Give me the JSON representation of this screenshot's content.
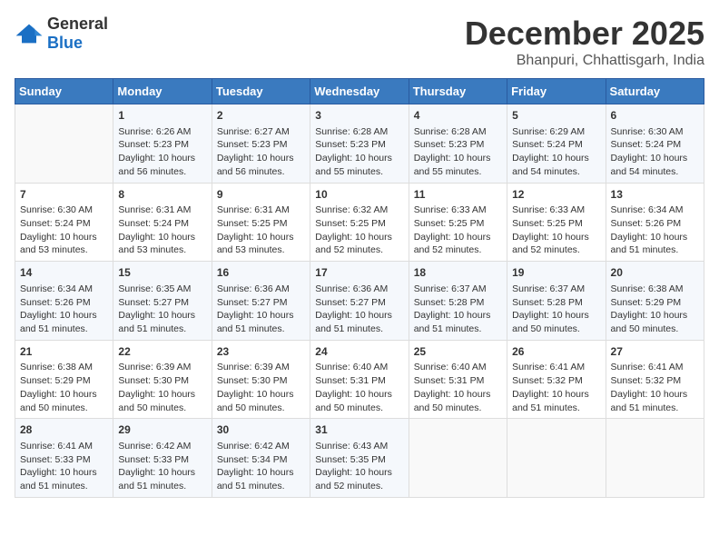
{
  "header": {
    "logo_general": "General",
    "logo_blue": "Blue",
    "month": "December 2025",
    "location": "Bhanpuri, Chhattisgarh, India"
  },
  "weekdays": [
    "Sunday",
    "Monday",
    "Tuesday",
    "Wednesday",
    "Thursday",
    "Friday",
    "Saturday"
  ],
  "weeks": [
    [
      {
        "day": "",
        "info": ""
      },
      {
        "day": "1",
        "info": "Sunrise: 6:26 AM\nSunset: 5:23 PM\nDaylight: 10 hours\nand 56 minutes."
      },
      {
        "day": "2",
        "info": "Sunrise: 6:27 AM\nSunset: 5:23 PM\nDaylight: 10 hours\nand 56 minutes."
      },
      {
        "day": "3",
        "info": "Sunrise: 6:28 AM\nSunset: 5:23 PM\nDaylight: 10 hours\nand 55 minutes."
      },
      {
        "day": "4",
        "info": "Sunrise: 6:28 AM\nSunset: 5:23 PM\nDaylight: 10 hours\nand 55 minutes."
      },
      {
        "day": "5",
        "info": "Sunrise: 6:29 AM\nSunset: 5:24 PM\nDaylight: 10 hours\nand 54 minutes."
      },
      {
        "day": "6",
        "info": "Sunrise: 6:30 AM\nSunset: 5:24 PM\nDaylight: 10 hours\nand 54 minutes."
      }
    ],
    [
      {
        "day": "7",
        "info": "Sunrise: 6:30 AM\nSunset: 5:24 PM\nDaylight: 10 hours\nand 53 minutes."
      },
      {
        "day": "8",
        "info": "Sunrise: 6:31 AM\nSunset: 5:24 PM\nDaylight: 10 hours\nand 53 minutes."
      },
      {
        "day": "9",
        "info": "Sunrise: 6:31 AM\nSunset: 5:25 PM\nDaylight: 10 hours\nand 53 minutes."
      },
      {
        "day": "10",
        "info": "Sunrise: 6:32 AM\nSunset: 5:25 PM\nDaylight: 10 hours\nand 52 minutes."
      },
      {
        "day": "11",
        "info": "Sunrise: 6:33 AM\nSunset: 5:25 PM\nDaylight: 10 hours\nand 52 minutes."
      },
      {
        "day": "12",
        "info": "Sunrise: 6:33 AM\nSunset: 5:25 PM\nDaylight: 10 hours\nand 52 minutes."
      },
      {
        "day": "13",
        "info": "Sunrise: 6:34 AM\nSunset: 5:26 PM\nDaylight: 10 hours\nand 51 minutes."
      }
    ],
    [
      {
        "day": "14",
        "info": "Sunrise: 6:34 AM\nSunset: 5:26 PM\nDaylight: 10 hours\nand 51 minutes."
      },
      {
        "day": "15",
        "info": "Sunrise: 6:35 AM\nSunset: 5:27 PM\nDaylight: 10 hours\nand 51 minutes."
      },
      {
        "day": "16",
        "info": "Sunrise: 6:36 AM\nSunset: 5:27 PM\nDaylight: 10 hours\nand 51 minutes."
      },
      {
        "day": "17",
        "info": "Sunrise: 6:36 AM\nSunset: 5:27 PM\nDaylight: 10 hours\nand 51 minutes."
      },
      {
        "day": "18",
        "info": "Sunrise: 6:37 AM\nSunset: 5:28 PM\nDaylight: 10 hours\nand 51 minutes."
      },
      {
        "day": "19",
        "info": "Sunrise: 6:37 AM\nSunset: 5:28 PM\nDaylight: 10 hours\nand 50 minutes."
      },
      {
        "day": "20",
        "info": "Sunrise: 6:38 AM\nSunset: 5:29 PM\nDaylight: 10 hours\nand 50 minutes."
      }
    ],
    [
      {
        "day": "21",
        "info": "Sunrise: 6:38 AM\nSunset: 5:29 PM\nDaylight: 10 hours\nand 50 minutes."
      },
      {
        "day": "22",
        "info": "Sunrise: 6:39 AM\nSunset: 5:30 PM\nDaylight: 10 hours\nand 50 minutes."
      },
      {
        "day": "23",
        "info": "Sunrise: 6:39 AM\nSunset: 5:30 PM\nDaylight: 10 hours\nand 50 minutes."
      },
      {
        "day": "24",
        "info": "Sunrise: 6:40 AM\nSunset: 5:31 PM\nDaylight: 10 hours\nand 50 minutes."
      },
      {
        "day": "25",
        "info": "Sunrise: 6:40 AM\nSunset: 5:31 PM\nDaylight: 10 hours\nand 50 minutes."
      },
      {
        "day": "26",
        "info": "Sunrise: 6:41 AM\nSunset: 5:32 PM\nDaylight: 10 hours\nand 51 minutes."
      },
      {
        "day": "27",
        "info": "Sunrise: 6:41 AM\nSunset: 5:32 PM\nDaylight: 10 hours\nand 51 minutes."
      }
    ],
    [
      {
        "day": "28",
        "info": "Sunrise: 6:41 AM\nSunset: 5:33 PM\nDaylight: 10 hours\nand 51 minutes."
      },
      {
        "day": "29",
        "info": "Sunrise: 6:42 AM\nSunset: 5:33 PM\nDaylight: 10 hours\nand 51 minutes."
      },
      {
        "day": "30",
        "info": "Sunrise: 6:42 AM\nSunset: 5:34 PM\nDaylight: 10 hours\nand 51 minutes."
      },
      {
        "day": "31",
        "info": "Sunrise: 6:43 AM\nSunset: 5:35 PM\nDaylight: 10 hours\nand 52 minutes."
      },
      {
        "day": "",
        "info": ""
      },
      {
        "day": "",
        "info": ""
      },
      {
        "day": "",
        "info": ""
      }
    ]
  ]
}
